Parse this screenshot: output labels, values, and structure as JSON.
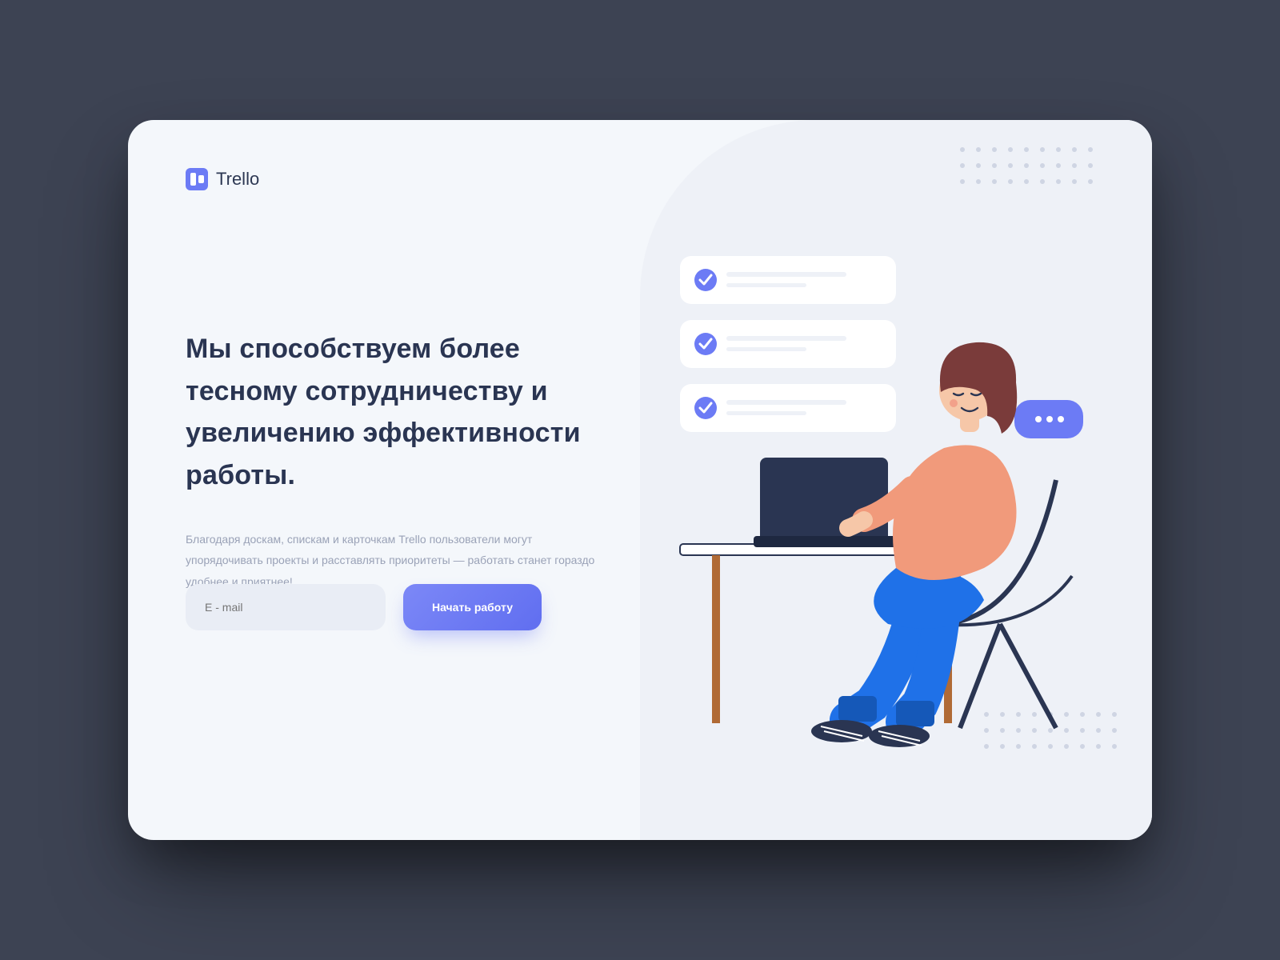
{
  "brand": {
    "name": "Trello"
  },
  "hero": {
    "headline": "Мы способствуем более тесному сотрудничеству и увеличению эффективности работы.",
    "subtext": "Благодаря доскам, спискам и карточкам Trello пользователи могут упорядочивать проекты и расставлять приоритеты — работать станет гораздо удобнее и приятнее!"
  },
  "form": {
    "email_placeholder": "E - mail",
    "cta_label": "Начать работу"
  },
  "colors": {
    "accent": "#6c7bf5",
    "text_dark": "#2a3552",
    "text_muted": "#9aa2b7",
    "page_bg": "#3d4353",
    "card_bg": "#f4f7fb"
  }
}
